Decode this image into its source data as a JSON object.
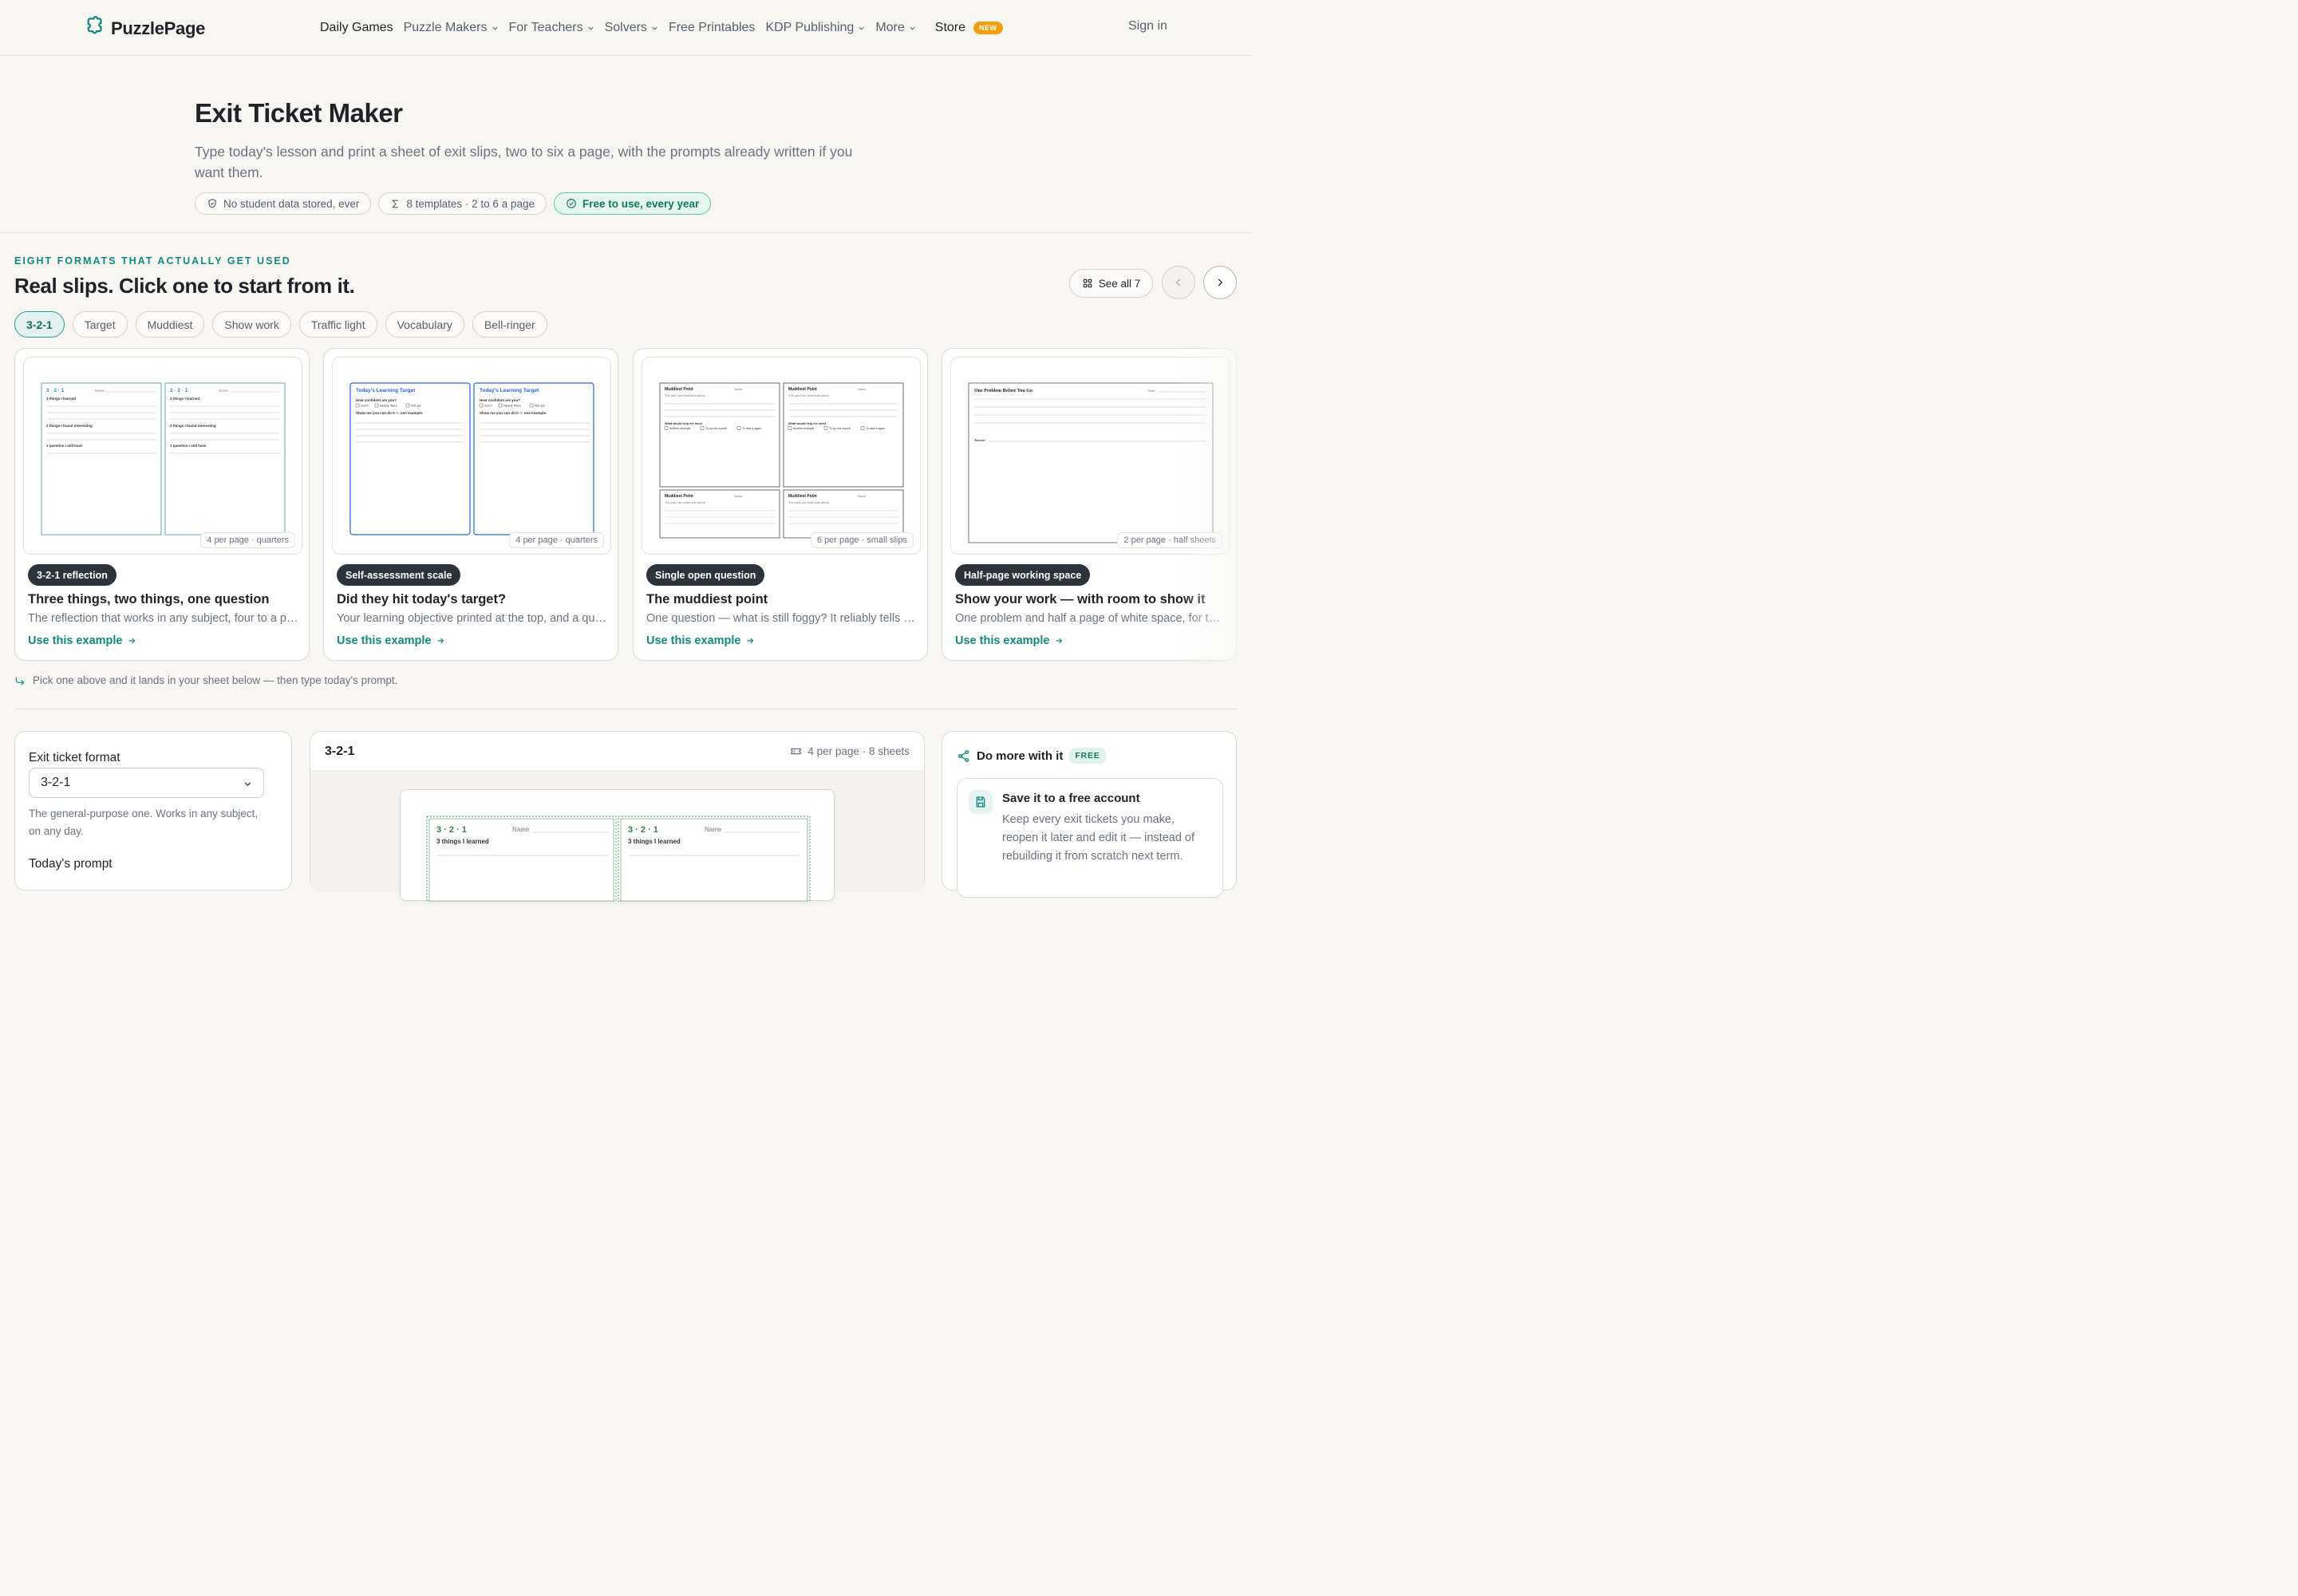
{
  "nav": {
    "brand": "PuzzlePage",
    "items": [
      {
        "label": "Daily Games",
        "strong": true,
        "chevron": false
      },
      {
        "label": "Puzzle Makers",
        "chevron": true
      },
      {
        "label": "For Teachers",
        "chevron": true
      },
      {
        "label": "Solvers",
        "chevron": true
      },
      {
        "label": "Free Printables",
        "chevron": false
      },
      {
        "label": "KDP Publishing",
        "chevron": true
      },
      {
        "label": "More",
        "chevron": true
      },
      {
        "label": "Store",
        "strong": true,
        "badge": "NEW"
      }
    ],
    "signin": "Sign in"
  },
  "hero": {
    "title": "Exit Ticket Maker",
    "subtitle": "Type today's lesson and print a sheet of exit slips, two to six a page, with the prompts already written if you want them.",
    "pills": [
      {
        "icon": "shield-icon",
        "label": "No student data stored, ever"
      },
      {
        "icon": "sigma-icon",
        "label": "8 templates · 2 to 6 a page"
      },
      {
        "icon": "check-circle-icon",
        "label": "Free to use, every year"
      }
    ]
  },
  "formats": {
    "eyebrow": "EIGHT FORMATS THAT ACTUALLY GET USED",
    "title": "Real slips. Click one to start from it.",
    "see_all": "See all 7",
    "chips": [
      "3-2-1",
      "Target",
      "Muddiest",
      "Show work",
      "Traffic light",
      "Vocabulary",
      "Bell-ringer"
    ],
    "active_chip": 0,
    "hint": "Pick one above and it lands in your sheet below — then type today's prompt.",
    "cards": [
      {
        "tag": "3-2-1 reflection",
        "title": "Three things, two things, one question",
        "desc": "The reflection that works in any subject, four to a page.",
        "link": "Use this example",
        "caption": "4 per page · quarters",
        "thumb": {
          "head": "3 · 2 · 1",
          "name": "Name",
          "lines": [
            "3 things I learned",
            "2 things I found interesting",
            "1 question I still have"
          ]
        }
      },
      {
        "tag": "Self-assessment scale",
        "title": "Did they hit today's target?",
        "desc": "Your learning objective printed at the top, and a quick self-check.",
        "link": "Use this example",
        "caption": "4 per page · quarters",
        "thumb": {
          "head": "Today's Learning Target",
          "q": "How confident are you?",
          "opts": [
            "Got it",
            "Nearly there",
            "Not yet"
          ],
          "show": "Show me you can do it — one example:"
        }
      },
      {
        "tag": "Single open question",
        "title": "The muddiest point",
        "desc": "One question — what is still foggy? It reliably tells you what to reteach.",
        "link": "Use this example",
        "caption": "6 per page · small slips",
        "thumb": {
          "head": "Muddiest Point",
          "name": "Name",
          "sub": "The part I am least sure about",
          "help": "What would help me most",
          "opts": [
            "Another example",
            "To try one myself",
            "To hear it again"
          ]
        }
      },
      {
        "tag": "Half-page working space",
        "title": "Show your work — with room to show it",
        "desc": "One problem and half a page of white space, for the working.",
        "link": "Use this example",
        "caption": "2 per page · half sheets",
        "thumb": {
          "head": "One Problem Before You Go",
          "name": "Name",
          "answer": "Answer"
        }
      }
    ]
  },
  "builder": {
    "format_label": "Exit ticket format",
    "format_value": "3-2-1",
    "format_desc": "The general-purpose one. Works in any subject, on any day.",
    "prompt_label": "Today's prompt",
    "preview_title": "3-2-1",
    "preview_meta": "4 per page · 8 sheets",
    "preview_sheet": {
      "head": "3 · 2 · 1",
      "name": "Name",
      "line": "3 things I learned"
    }
  },
  "more": {
    "title": "Do more with it",
    "badge": "FREE",
    "card_title": "Save it to a free account",
    "card_desc": "Keep every exit tickets you make, reopen it later and edit it — instead of rebuilding it from scratch next term."
  },
  "colors": {
    "accent": "#0f8a80",
    "badge_new": "#f59e0b",
    "tag_dark": "#2d333b",
    "thumb_blue": "#2563eb",
    "thumb_teal": "#7bb8c9",
    "sheet_green": "#2e7d4f"
  }
}
